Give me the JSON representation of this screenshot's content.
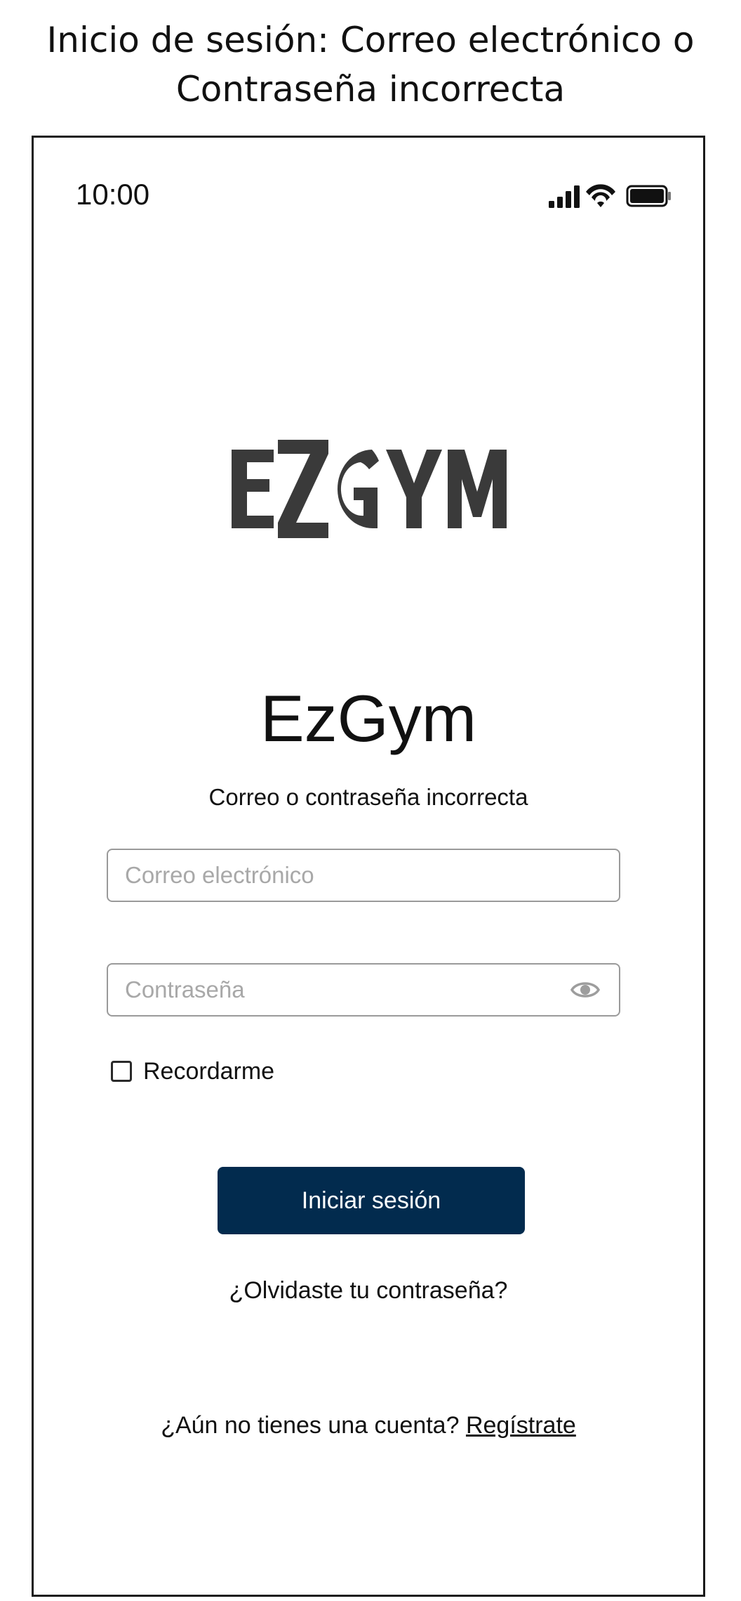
{
  "screen_title": {
    "line1": "Inicio de sesión: Correo electrónico o",
    "line2": "Contraseña incorrecta"
  },
  "status_bar": {
    "time": "10:00",
    "icons": [
      "signal-icon",
      "wifi-icon",
      "battery-icon"
    ]
  },
  "logo": {
    "text": "EZGYM",
    "color": "#3a3a3a"
  },
  "app_name": "EzGym",
  "error_message": "Correo o contraseña incorrecta",
  "form": {
    "email_placeholder": "Correo electrónico",
    "email_value": "",
    "password_placeholder": "Contraseña",
    "password_value": "",
    "password_toggle_icon": "eye-icon",
    "remember_label": "Recordarme",
    "remember_checked": false,
    "login_label": "Iniciar sesión"
  },
  "links": {
    "forgot_password": "¿Olvidaste tu contraseña?",
    "no_account": "¿Aún no tienes una cuenta?",
    "register": "Regístrate"
  },
  "colors": {
    "primary_button": "#022b4e",
    "input_border": "#9a9a9a",
    "placeholder": "#a8a8a8"
  }
}
